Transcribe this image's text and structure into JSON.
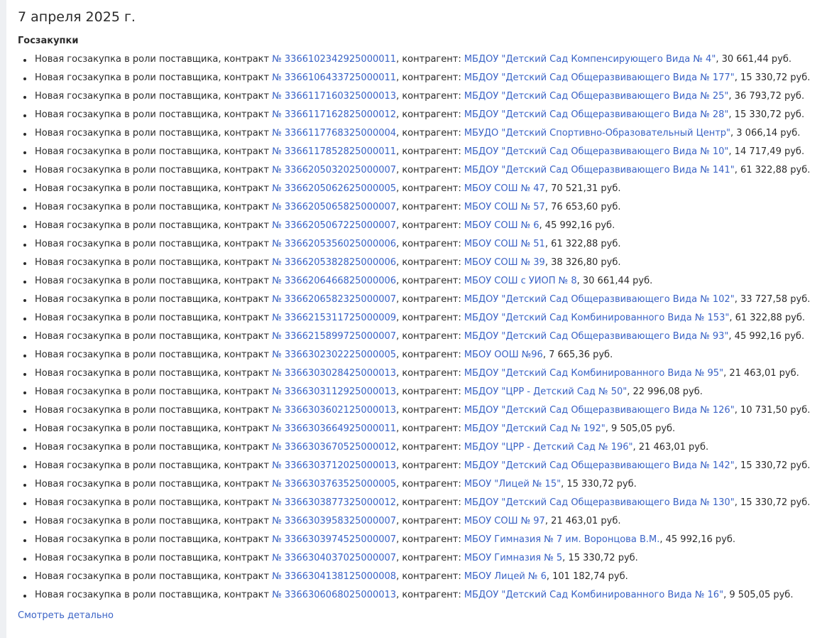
{
  "date_title": "7 апреля 2025 г.",
  "section_title": "Госзакупки",
  "more_link": "Смотреть детально",
  "items": [
    {
      "prefix": "Новая госзакупка в роли поставщика, контракт ",
      "contract": "№ 3366102342925000011",
      "mid": ", контрагент: ",
      "counterparty": "МБДОУ \"Детский Сад Компенсирующего Вида № 4\"",
      "amount": ", 30 661,44 руб."
    },
    {
      "prefix": "Новая госзакупка в роли поставщика, контракт ",
      "contract": "№ 3366106433725000011",
      "mid": ", контрагент: ",
      "counterparty": "МБДОУ \"Детский Сад Общеразвивающего Вида № 177\"",
      "amount": ", 15 330,72 руб."
    },
    {
      "prefix": "Новая госзакупка в роли поставщика, контракт ",
      "contract": "№ 3366117160325000013",
      "mid": ", контрагент: ",
      "counterparty": "МБДОУ \"Детский Сад Общеразвивающего Вида № 25\"",
      "amount": ", 36 793,72 руб."
    },
    {
      "prefix": "Новая госзакупка в роли поставщика, контракт ",
      "contract": "№ 3366117162825000012",
      "mid": ", контрагент: ",
      "counterparty": "МБДОУ \"Детский Сад Общеразвивающего Вида № 28\"",
      "amount": ", 15 330,72 руб."
    },
    {
      "prefix": "Новая госзакупка в роли поставщика, контракт ",
      "contract": "№ 3366117768325000004",
      "mid": ", контрагент: ",
      "counterparty": "МБУДО \"Детский Спортивно-Образовательный Центр\"",
      "amount": ", 3 066,14 руб."
    },
    {
      "prefix": "Новая госзакупка в роли поставщика, контракт ",
      "contract": "№ 3366117852825000011",
      "mid": ", контрагент: ",
      "counterparty": "МБДОУ \"Детский Сад Общеразвивающего Вида № 10\"",
      "amount": ", 14 717,49 руб."
    },
    {
      "prefix": "Новая госзакупка в роли поставщика, контракт ",
      "contract": "№ 3366205032025000007",
      "mid": ", контрагент: ",
      "counterparty": "МБДОУ \"Детский Сад Общеразвивающего Вида № 141\"",
      "amount": ", 61 322,88 руб."
    },
    {
      "prefix": "Новая госзакупка в роли поставщика, контракт ",
      "contract": "№ 3366205062625000005",
      "mid": ", контрагент: ",
      "counterparty": "МБОУ СОШ № 47",
      "amount": ", 70 521,31 руб."
    },
    {
      "prefix": "Новая госзакупка в роли поставщика, контракт ",
      "contract": "№ 3366205065825000007",
      "mid": ", контрагент: ",
      "counterparty": "МБОУ СОШ № 57",
      "amount": ", 76 653,60 руб."
    },
    {
      "prefix": "Новая госзакупка в роли поставщика, контракт ",
      "contract": "№ 3366205067225000007",
      "mid": ", контрагент: ",
      "counterparty": "МБОУ СОШ № 6",
      "amount": ", 45 992,16 руб."
    },
    {
      "prefix": "Новая госзакупка в роли поставщика, контракт ",
      "contract": "№ 3366205356025000006",
      "mid": ", контрагент: ",
      "counterparty": "МБОУ СОШ № 51",
      "amount": ", 61 322,88 руб."
    },
    {
      "prefix": "Новая госзакупка в роли поставщика, контракт ",
      "contract": "№ 3366205382825000006",
      "mid": ", контрагент: ",
      "counterparty": "МБОУ СОШ № 39",
      "amount": ", 38 326,80 руб."
    },
    {
      "prefix": "Новая госзакупка в роли поставщика, контракт ",
      "contract": "№ 3366206466825000006",
      "mid": ", контрагент: ",
      "counterparty": "МБОУ СОШ с УИОП № 8",
      "amount": ", 30 661,44 руб."
    },
    {
      "prefix": "Новая госзакупка в роли поставщика, контракт ",
      "contract": "№ 3366206582325000007",
      "mid": ", контрагент: ",
      "counterparty": "МБДОУ \"Детский Сад Общеразвивающего Вида № 102\"",
      "amount": ", 33 727,58 руб."
    },
    {
      "prefix": "Новая госзакупка в роли поставщика, контракт ",
      "contract": "№ 3366215311725000009",
      "mid": ", контрагент: ",
      "counterparty": "МБДОУ \"Детский Сад Комбинированного Вида № 153\"",
      "amount": ", 61 322,88 руб."
    },
    {
      "prefix": "Новая госзакупка в роли поставщика, контракт ",
      "contract": "№ 3366215899725000007",
      "mid": ", контрагент: ",
      "counterparty": "МБДОУ \"Детский Сад Общеразвивающего Вида № 93\"",
      "amount": ", 45 992,16 руб."
    },
    {
      "prefix": "Новая госзакупка в роли поставщика, контракт ",
      "contract": "№ 3366302302225000005",
      "mid": ", контрагент: ",
      "counterparty": "МБОУ ООШ №96",
      "amount": ", 7 665,36 руб."
    },
    {
      "prefix": "Новая госзакупка в роли поставщика, контракт ",
      "contract": "№ 3366303028425000013",
      "mid": ", контрагент: ",
      "counterparty": "МБДОУ \"Детский Сад Комбинированного Вида № 95\"",
      "amount": ", 21 463,01 руб."
    },
    {
      "prefix": "Новая госзакупка в роли поставщика, контракт ",
      "contract": "№ 3366303112925000013",
      "mid": ", контрагент: ",
      "counterparty": "МБДОУ \"ЦРР - Детский Сад № 50\"",
      "amount": ", 22 996,08 руб."
    },
    {
      "prefix": "Новая госзакупка в роли поставщика, контракт ",
      "contract": "№ 3366303602125000013",
      "mid": ", контрагент: ",
      "counterparty": "МБДОУ \"Детский Сад Общеразвивающего Вида № 126\"",
      "amount": ", 10 731,50 руб."
    },
    {
      "prefix": "Новая госзакупка в роли поставщика, контракт ",
      "contract": "№ 3366303664925000011",
      "mid": ", контрагент: ",
      "counterparty": "МБДОУ \"Детский Сад № 192\"",
      "amount": ", 9 505,05 руб."
    },
    {
      "prefix": "Новая госзакупка в роли поставщика, контракт ",
      "contract": "№ 3366303670525000012",
      "mid": ", контрагент: ",
      "counterparty": "МБДОУ \"ЦРР - Детский Сад № 196\"",
      "amount": ", 21 463,01 руб."
    },
    {
      "prefix": "Новая госзакупка в роли поставщика, контракт ",
      "contract": "№ 3366303712025000013",
      "mid": ", контрагент: ",
      "counterparty": "МБДОУ \"Детский Сад Общеразвивающего Вида № 142\"",
      "amount": ", 15 330,72 руб."
    },
    {
      "prefix": "Новая госзакупка в роли поставщика, контракт ",
      "contract": "№ 3366303763525000005",
      "mid": ", контрагент: ",
      "counterparty": "МБОУ \"Лицей № 15\"",
      "amount": ", 15 330,72 руб."
    },
    {
      "prefix": "Новая госзакупка в роли поставщика, контракт ",
      "contract": "№ 3366303877325000012",
      "mid": ", контрагент: ",
      "counterparty": "МБДОУ \"Детский Сад Общеразвивающего Вида № 130\"",
      "amount": ", 15 330,72 руб."
    },
    {
      "prefix": "Новая госзакупка в роли поставщика, контракт ",
      "contract": "№ 3366303958325000007",
      "mid": ", контрагент: ",
      "counterparty": "МБОУ СОШ № 97",
      "amount": ", 21 463,01 руб."
    },
    {
      "prefix": "Новая госзакупка в роли поставщика, контракт ",
      "contract": "№ 3366303974525000007",
      "mid": ", контрагент: ",
      "counterparty": "МБОУ Гимназия № 7 им. Воронцова В.М.",
      "amount": ", 45 992,16 руб."
    },
    {
      "prefix": "Новая госзакупка в роли поставщика, контракт ",
      "contract": "№ 3366304037025000007",
      "mid": ", контрагент: ",
      "counterparty": "МБОУ Гимназия № 5",
      "amount": ", 15 330,72 руб."
    },
    {
      "prefix": "Новая госзакупка в роли поставщика, контракт ",
      "contract": "№ 3366304138125000008",
      "mid": ", контрагент: ",
      "counterparty": "МБОУ Лицей № 6",
      "amount": ", 101 182,74 руб."
    },
    {
      "prefix": "Новая госзакупка в роли поставщика, контракт ",
      "contract": "№ 3366306068025000013",
      "mid": ", контрагент: ",
      "counterparty": "МБДОУ \"Детский Сад Комбинированного Вида № 16\"",
      "amount": ", 9 505,05 руб."
    }
  ]
}
